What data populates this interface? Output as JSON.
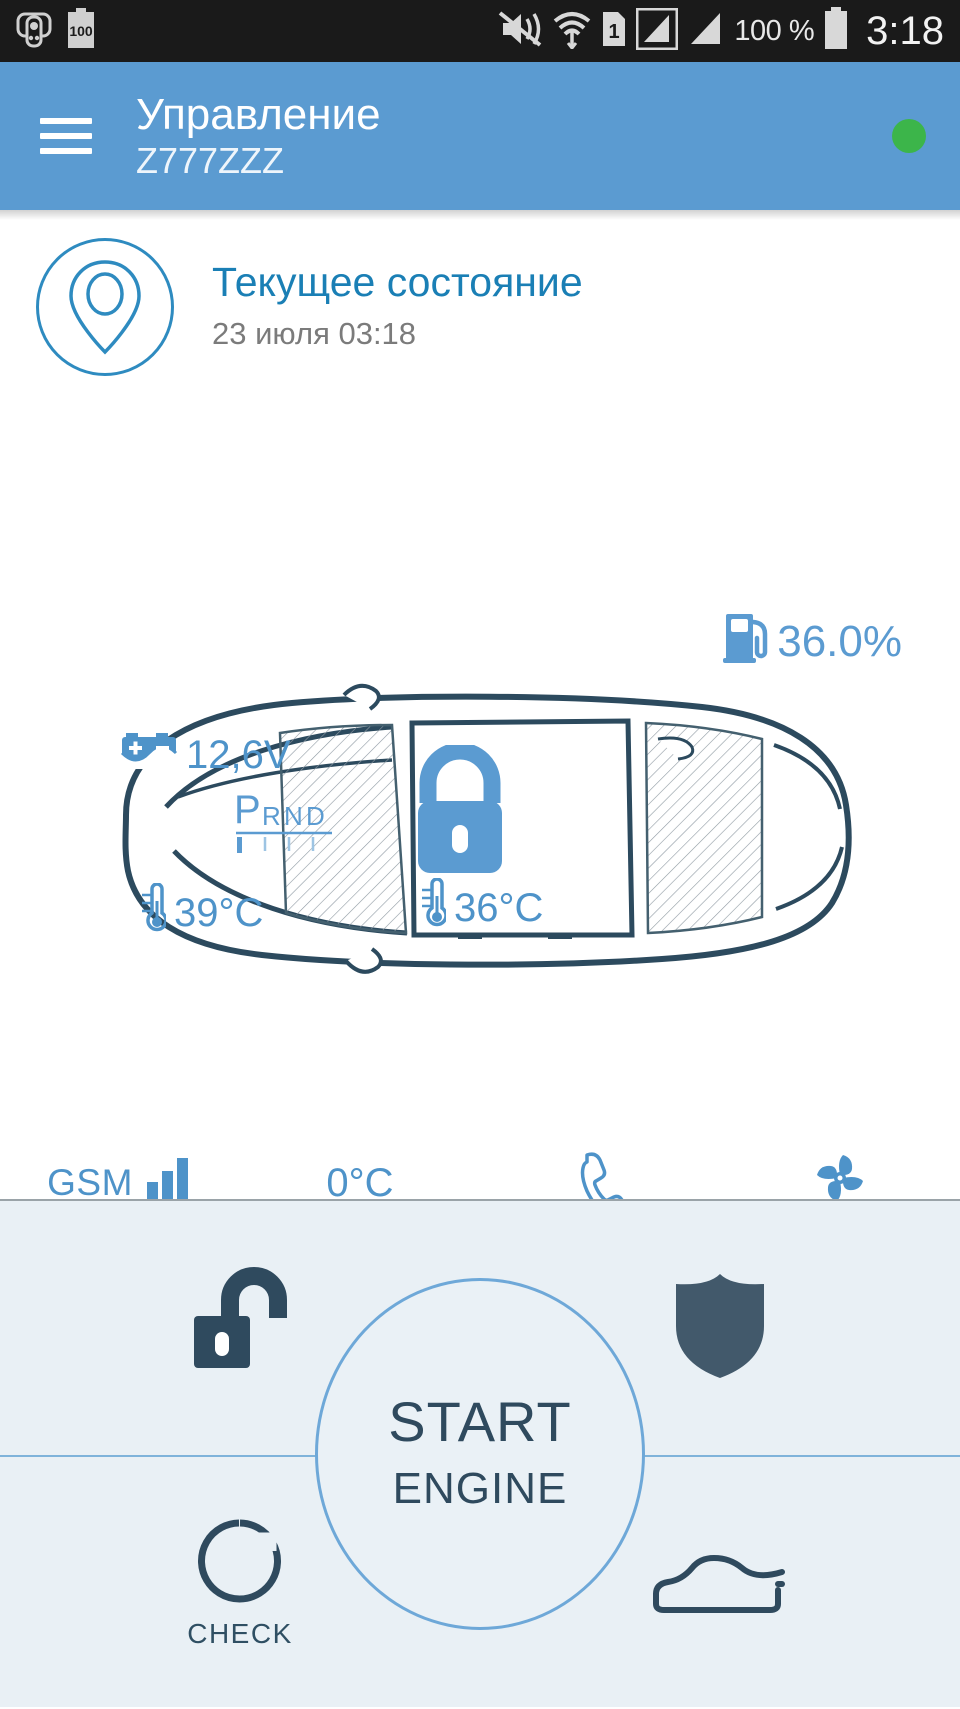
{
  "statusbar": {
    "left_icons": [
      "keyfob-icon",
      "device-battery-icon"
    ],
    "device_battery_label": "100",
    "right_icons": [
      "mute-vibrate-icon",
      "wifi-icon",
      "sim1-icon",
      "signal-bars-1-icon",
      "signal-bars-2-icon"
    ],
    "sim_label": "1",
    "battery_percent": "100 %",
    "clock": "3:18"
  },
  "appbar": {
    "menu_icon": "hamburger-menu-icon",
    "title": "Управление",
    "subtitle": "Z777ZZZ",
    "status_dot_color": "#3cb54a",
    "background_color": "#5b9bd1"
  },
  "state": {
    "pin_icon": "location-pin-icon",
    "title": "Текущее состояние",
    "timestamp": "23 июля 03:18",
    "title_color": "#1a7fb5"
  },
  "car": {
    "fuel": {
      "icon": "fuel-pump-icon",
      "value": "36.0%"
    },
    "battery": {
      "icon": "car-battery-icon",
      "value": "12,6V"
    },
    "gear": {
      "icon": "gear-selector-icon",
      "selected": "P",
      "positions": [
        "P",
        "R",
        "N",
        "D"
      ]
    },
    "lock": {
      "icon": "padlock-open-icon",
      "state": "unlocked"
    },
    "engine_temp": {
      "icon": "thermometer-icon",
      "value": "39°C"
    },
    "cabin_temp": {
      "icon": "thermometer-icon",
      "value": "36°C"
    },
    "accent_color": "#4e93c9",
    "outline_color": "#2c4a5e"
  },
  "status_row": [
    {
      "name": "gsm-signal",
      "label": "GSM",
      "icon": "signal-bars-icon",
      "bars": 3
    },
    {
      "name": "outside-temperature",
      "label": "0°C",
      "icon": null
    },
    {
      "name": "phone-call",
      "label": "",
      "icon": "phone-handset-icon"
    },
    {
      "name": "climate-fan",
      "label": "",
      "icon": "fan-icon"
    }
  ],
  "panel": {
    "background_color": "#e9f0f5",
    "unlock": {
      "icon": "padlock-open-icon",
      "label": ""
    },
    "guard": {
      "icon": "shield-icon",
      "label": ""
    },
    "check": {
      "icon": "check-circle-icon",
      "label": "CHECK"
    },
    "trunk": {
      "icon": "car-trunk-icon",
      "label": ""
    },
    "start": {
      "main_label": "START",
      "sub_label": "ENGINE",
      "border_color": "#6ea8d8"
    }
  }
}
